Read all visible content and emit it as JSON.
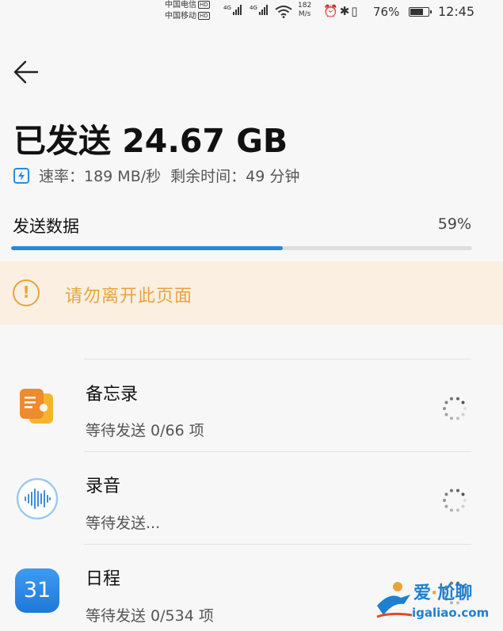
{
  "status_bar": {
    "carrier1": "中国电信",
    "carrier2": "中国移动",
    "hd": "HD",
    "net": "4G",
    "speed_value": "182",
    "speed_unit": "M/s",
    "battery_pct": "76%",
    "battery_level": 0.76,
    "time": "12:45"
  },
  "header": {
    "title": "已发送 24.67 GB",
    "rate": "速率：189 MB/秒",
    "remaining": "剩余时间：49 分钟"
  },
  "progress": {
    "label": "发送数据",
    "percent_text": "59%",
    "value": 0.59
  },
  "warning": {
    "text": "请勿离开此页面",
    "icon_glyph": "!"
  },
  "items": [
    {
      "name": "备忘录",
      "status": "等待发送 0/66 项",
      "icon": "notes-icon"
    },
    {
      "name": "录音",
      "status": "等待发送...",
      "icon": "recorder-icon"
    },
    {
      "name": "日程",
      "status": "等待发送 0/534 项",
      "icon": "calendar-icon",
      "icon_text": "31"
    }
  ],
  "watermark": {
    "text1": "爱",
    "text2": "尬聊",
    "url": "igaliao.com"
  },
  "colors": {
    "accent": "#2b86d6",
    "warning": "#e8a43c",
    "warning_bg": "#fbefe2"
  }
}
